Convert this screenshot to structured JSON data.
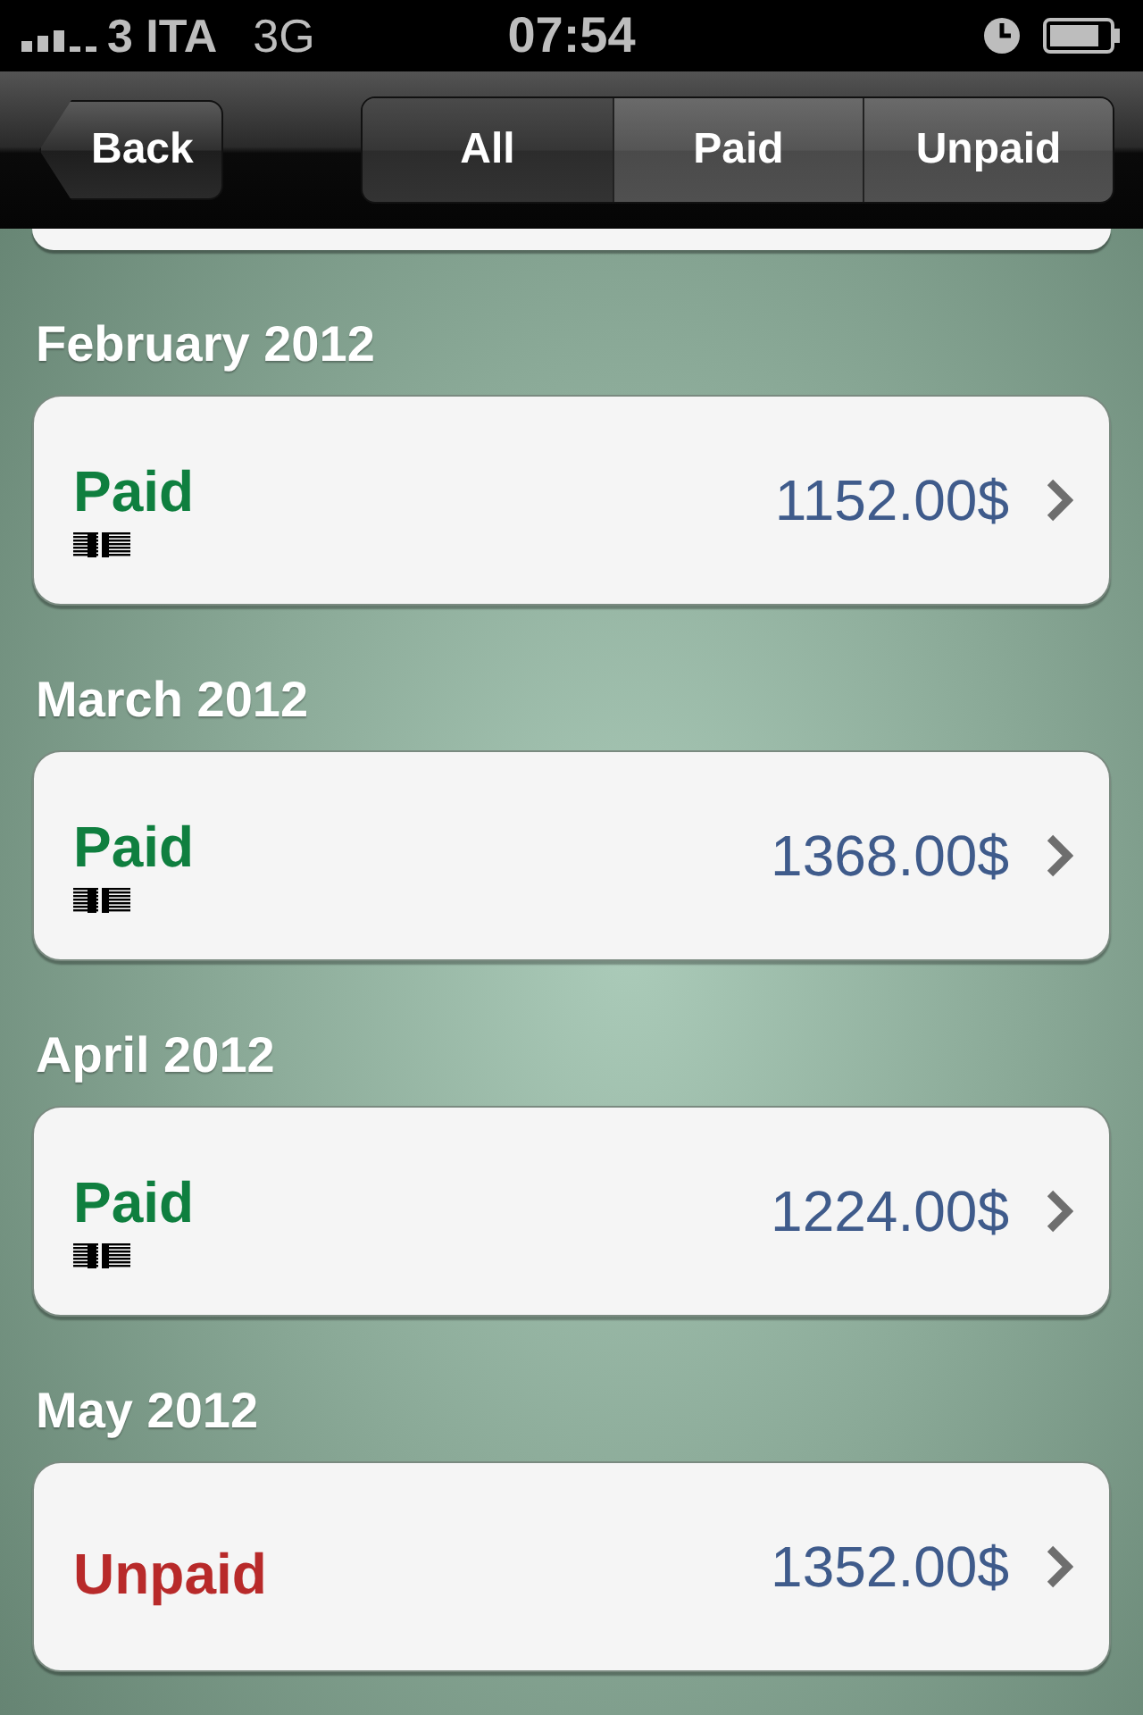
{
  "status_bar": {
    "carrier": "3 ITA",
    "network": "3G",
    "time": "07:54"
  },
  "nav_bar": {
    "back": "Back",
    "segments": [
      {
        "label": "All",
        "selected": true
      },
      {
        "label": "Paid",
        "selected": false
      },
      {
        "label": "Unpaid",
        "selected": false
      }
    ]
  },
  "sections": [
    {
      "title": "February 2012",
      "status": "Paid",
      "kind": "paid",
      "amount": "1152.00$"
    },
    {
      "title": "March 2012",
      "status": "Paid",
      "kind": "paid",
      "amount": "1368.00$"
    },
    {
      "title": "April 2012",
      "status": "Paid",
      "kind": "paid",
      "amount": "1224.00$"
    },
    {
      "title": "May 2012",
      "status": "Unpaid",
      "kind": "unpaid",
      "amount": "1352.00$"
    }
  ]
}
